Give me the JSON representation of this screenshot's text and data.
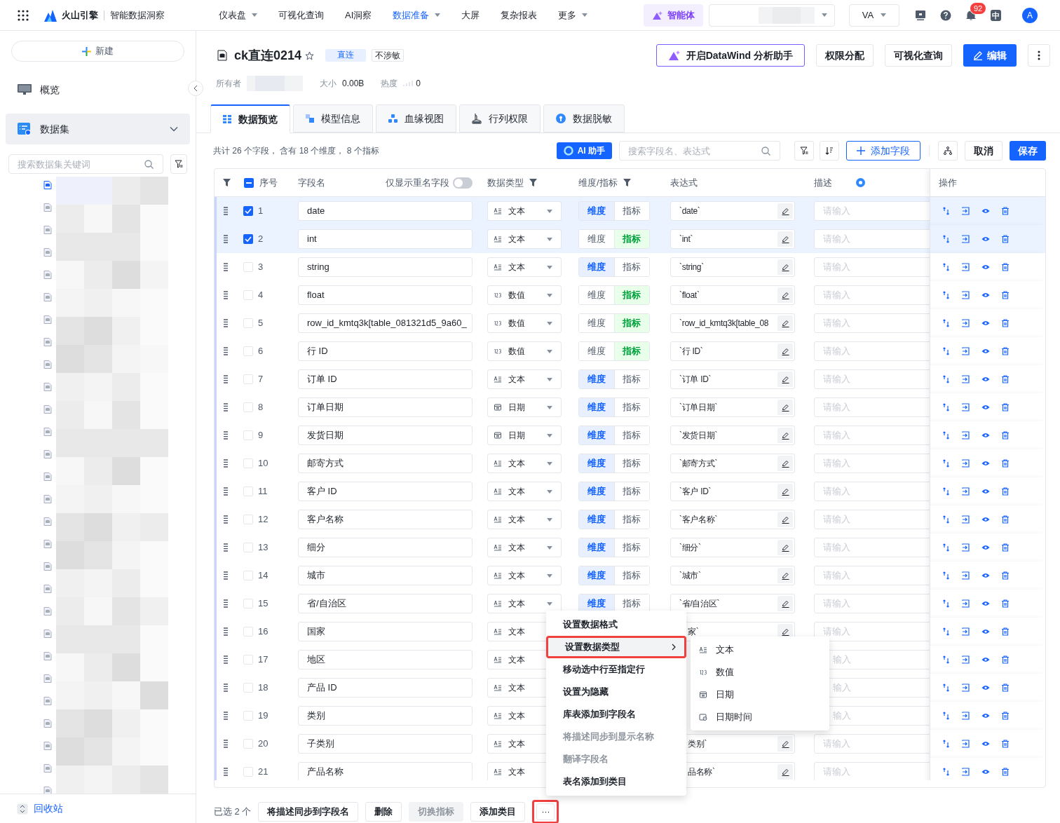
{
  "topbar": {
    "brand": "火山引擎",
    "product": "智能数据洞察",
    "nav": [
      {
        "label": "仪表盘",
        "dropdown": true,
        "selected": false
      },
      {
        "label": "可视化查询",
        "dropdown": false,
        "selected": false
      },
      {
        "label": "AI洞察",
        "dropdown": false,
        "selected": false
      },
      {
        "label": "数据准备",
        "dropdown": true,
        "selected": true
      },
      {
        "label": "大屏",
        "dropdown": false,
        "selected": false
      },
      {
        "label": "复杂报表",
        "dropdown": false,
        "selected": false
      },
      {
        "label": "更多",
        "dropdown": true,
        "selected": false
      }
    ],
    "agent_button": "智能体",
    "user_select": "VA",
    "notification_count": "92",
    "language": "中",
    "avatar": "A"
  },
  "sidebar": {
    "new_button": "新建",
    "items": [
      {
        "label": "概览",
        "selected": false,
        "expandable": false
      },
      {
        "label": "数据集",
        "selected": true,
        "expandable": true
      }
    ],
    "search": {
      "placeholder": "搜索数据集关键词"
    },
    "recycle_bin": "回收站"
  },
  "dataset": {
    "title": "ck直连0214",
    "tags": [
      {
        "label": "直连",
        "kind": "filled"
      },
      {
        "label": "不涉敏",
        "kind": "outline"
      }
    ],
    "actions": [
      {
        "label": "开启DataWind 分析助手",
        "kind": "assistant"
      },
      {
        "label": "权限分配",
        "kind": "default"
      },
      {
        "label": "可视化查询",
        "kind": "default"
      },
      {
        "label": "编辑",
        "kind": "primary"
      }
    ],
    "meta": [
      {
        "label": "所有者",
        "kind": "redacted"
      },
      {
        "label": "大小",
        "value": "0.00B",
        "kind": "text"
      },
      {
        "label": "热度",
        "value": "0",
        "kind": "heat"
      }
    ]
  },
  "tabs": [
    {
      "label": "数据预览",
      "selected": true
    },
    {
      "label": "模型信息",
      "selected": false
    },
    {
      "label": "血缘视图",
      "selected": false
    },
    {
      "label": "行列权限",
      "selected": false
    },
    {
      "label": "数据脱敏",
      "selected": false
    }
  ],
  "toolbar": {
    "summary": "共计 26 个字段， 含有 18 个维度， 8 个指标",
    "ai_button": "AI 助手",
    "search": {
      "placeholder": "搜索字段名、表达式"
    },
    "add_button": "添加字段",
    "cancel_button": "取消",
    "save_button": "保存"
  },
  "table": {
    "columns": [
      "序号",
      "字段名",
      "数据类型",
      "维度/指标",
      "表达式",
      "描述",
      "操作"
    ],
    "duplicate_toggle": {
      "label": "仅显示重名字段",
      "on": false
    },
    "header_indeterminate": true,
    "rows": [
      {
        "index": "1",
        "name": "date",
        "type": {
          "label": "文本",
          "kind": "text"
        },
        "roles": [
          {
            "label": "维度",
            "selected": true
          },
          {
            "label": "指标",
            "selected": false
          }
        ],
        "expression": "`date`",
        "description_placeholder": "请输入",
        "checked": true
      },
      {
        "index": "2",
        "name": "int",
        "type": {
          "label": "文本",
          "kind": "text"
        },
        "roles": [
          {
            "label": "维度",
            "selected": false
          },
          {
            "label": "指标",
            "selected": true
          }
        ],
        "expression": "`int`",
        "description_placeholder": "请输入",
        "checked": true
      },
      {
        "index": "3",
        "name": "string",
        "type": {
          "label": "文本",
          "kind": "text"
        },
        "roles": [
          {
            "label": "维度",
            "selected": true
          },
          {
            "label": "指标",
            "selected": false
          }
        ],
        "expression": "`string`",
        "description_placeholder": "请输入",
        "checked": false
      },
      {
        "index": "4",
        "name": "float",
        "type": {
          "label": "数值",
          "kind": "decimal"
        },
        "roles": [
          {
            "label": "维度",
            "selected": false
          },
          {
            "label": "指标",
            "selected": true
          }
        ],
        "expression": "`float`",
        "description_placeholder": "请输入",
        "checked": false
      },
      {
        "index": "5",
        "name": "row_id_kmtq3k[table_081321d5_9a60_",
        "type": {
          "label": "数值",
          "kind": "integer"
        },
        "roles": [
          {
            "label": "维度",
            "selected": false
          },
          {
            "label": "指标",
            "selected": true
          }
        ],
        "expression": "`row_id_kmtq3k[table_08",
        "description_placeholder": "请输入",
        "checked": false
      },
      {
        "index": "6",
        "name": "行 ID",
        "type": {
          "label": "数值",
          "kind": "integer"
        },
        "roles": [
          {
            "label": "维度",
            "selected": false
          },
          {
            "label": "指标",
            "selected": true
          }
        ],
        "expression": "`行 ID`",
        "description_placeholder": "请输入",
        "checked": false
      },
      {
        "index": "7",
        "name": "订单 ID",
        "type": {
          "label": "文本",
          "kind": "text"
        },
        "roles": [
          {
            "label": "维度",
            "selected": true
          },
          {
            "label": "指标",
            "selected": false
          }
        ],
        "expression": "`订单 ID`",
        "description_placeholder": "请输入",
        "checked": false
      },
      {
        "index": "8",
        "name": "订单日期",
        "type": {
          "label": "日期",
          "kind": "date"
        },
        "roles": [
          {
            "label": "维度",
            "selected": true
          },
          {
            "label": "指标",
            "selected": false
          }
        ],
        "expression": "`订单日期`",
        "description_placeholder": "请输入",
        "checked": false
      },
      {
        "index": "9",
        "name": "发货日期",
        "type": {
          "label": "日期",
          "kind": "date"
        },
        "roles": [
          {
            "label": "维度",
            "selected": true
          },
          {
            "label": "指标",
            "selected": false
          }
        ],
        "expression": "`发货日期`",
        "description_placeholder": "请输入",
        "checked": false
      },
      {
        "index": "10",
        "name": "邮寄方式",
        "type": {
          "label": "文本",
          "kind": "text"
        },
        "roles": [
          {
            "label": "维度",
            "selected": true
          },
          {
            "label": "指标",
            "selected": false
          }
        ],
        "expression": "`邮寄方式`",
        "description_placeholder": "请输入",
        "checked": false
      },
      {
        "index": "11",
        "name": "客户 ID",
        "type": {
          "label": "文本",
          "kind": "text"
        },
        "roles": [
          {
            "label": "维度",
            "selected": true
          },
          {
            "label": "指标",
            "selected": false
          }
        ],
        "expression": "`客户 ID`",
        "description_placeholder": "请输入",
        "checked": false
      },
      {
        "index": "12",
        "name": "客户名称",
        "type": {
          "label": "文本",
          "kind": "text"
        },
        "roles": [
          {
            "label": "维度",
            "selected": true
          },
          {
            "label": "指标",
            "selected": false
          }
        ],
        "expression": "`客户名称`",
        "description_placeholder": "请输入",
        "checked": false
      },
      {
        "index": "13",
        "name": "细分",
        "type": {
          "label": "文本",
          "kind": "text"
        },
        "roles": [
          {
            "label": "维度",
            "selected": true
          },
          {
            "label": "指标",
            "selected": false
          }
        ],
        "expression": "`细分`",
        "description_placeholder": "请输入",
        "checked": false
      },
      {
        "index": "14",
        "name": "城市",
        "type": {
          "label": "文本",
          "kind": "text"
        },
        "roles": [
          {
            "label": "维度",
            "selected": true
          },
          {
            "label": "指标",
            "selected": false
          }
        ],
        "expression": "`城市`",
        "description_placeholder": "请输入",
        "checked": false
      },
      {
        "index": "15",
        "name": "省/自治区",
        "type": {
          "label": "文本",
          "kind": "text"
        },
        "roles": [
          {
            "label": "维度",
            "selected": true
          },
          {
            "label": "指标",
            "selected": false
          }
        ],
        "expression": "`省/自治区`",
        "description_placeholder": "请输入",
        "checked": false
      },
      {
        "index": "16",
        "name": "国家",
        "type": {
          "label": "文本",
          "kind": "text"
        },
        "expression": "家`",
        "expression_cut": true,
        "description_placeholder": "请输入",
        "checked": false
      },
      {
        "index": "17",
        "name": "地区",
        "type": {
          "label": "文本",
          "kind": "text"
        },
        "description_placeholder": "输入",
        "description_cut": true,
        "checked": false
      },
      {
        "index": "18",
        "name": "产品 ID",
        "type": {
          "label": "文本",
          "kind": "text"
        },
        "description_placeholder": "输入",
        "description_cut": true,
        "checked": false
      },
      {
        "index": "19",
        "name": "类别",
        "type": {
          "label": "文本",
          "kind": "text"
        },
        "description_placeholder": "输入",
        "description_cut": true,
        "checked": false
      },
      {
        "index": "20",
        "name": "子类别",
        "type": {
          "label": "文本",
          "kind": "text"
        },
        "expression": "类别`",
        "expression_cut": true,
        "description_placeholder": "请输入",
        "checked": false
      },
      {
        "index": "21",
        "name": "产品名称",
        "type": {
          "label": "文本",
          "kind": "text"
        },
        "expression": "品名称`",
        "expression_cut": true,
        "description_placeholder": "请输入",
        "checked": false
      }
    ]
  },
  "bottom_bar": {
    "selected_count": "已选 2 个",
    "buttons": [
      {
        "label": "将描述同步到字段名",
        "disabled": false
      },
      {
        "label": "删除",
        "disabled": false
      },
      {
        "label": "切换指标",
        "disabled": true
      },
      {
        "label": "添加类目",
        "disabled": false
      }
    ],
    "more_button": {
      "label": "···",
      "highlighted": true
    }
  },
  "context_menu": {
    "items": [
      {
        "label": "设置数据格式",
        "disabled": false,
        "highlighted": false,
        "submenu": false
      },
      {
        "label": "设置数据类型",
        "disabled": false,
        "highlighted": true,
        "submenu": true
      },
      {
        "label": "移动选中行至指定行",
        "disabled": false,
        "highlighted": false,
        "submenu": false
      },
      {
        "label": "设置为隐藏",
        "disabled": false,
        "highlighted": false,
        "submenu": false
      },
      {
        "label": "库表添加到字段名",
        "disabled": false,
        "highlighted": false,
        "submenu": false
      },
      {
        "label": "将描述同步到显示名称",
        "disabled": true,
        "highlighted": false,
        "submenu": false
      },
      {
        "label": "翻译字段名",
        "disabled": true,
        "highlighted": false,
        "submenu": false
      },
      {
        "label": "表名添加到类目",
        "disabled": false,
        "highlighted": false,
        "submenu": false
      }
    ],
    "submenu": [
      {
        "label": "文本",
        "kind": "text"
      },
      {
        "label": "数值",
        "kind": "decimal"
      },
      {
        "label": "日期",
        "kind": "date"
      },
      {
        "label": "日期时间",
        "kind": "datetime"
      }
    ]
  }
}
